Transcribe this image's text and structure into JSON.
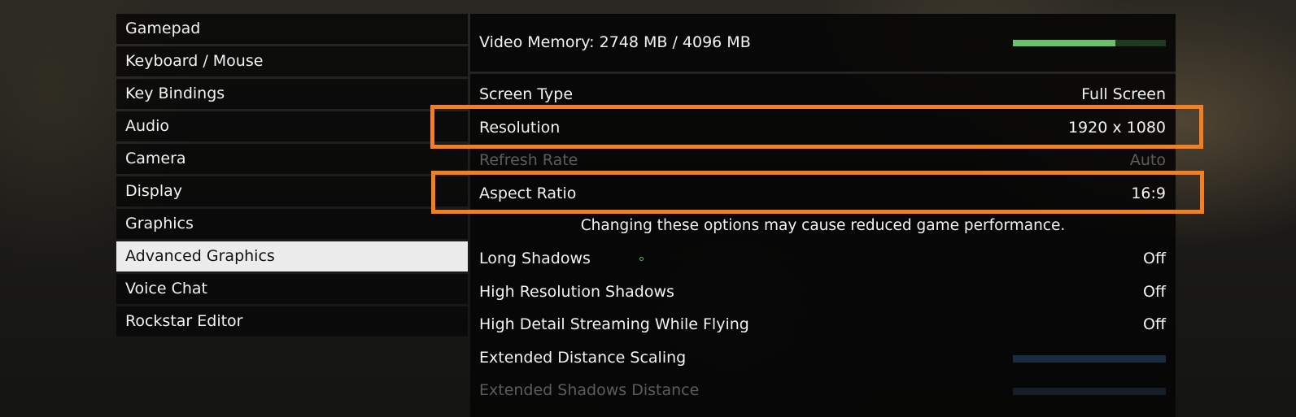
{
  "menu": {
    "items": [
      {
        "label": "Gamepad",
        "active": false
      },
      {
        "label": "Keyboard / Mouse",
        "active": false
      },
      {
        "label": "Key Bindings",
        "active": false
      },
      {
        "label": "Audio",
        "active": false
      },
      {
        "label": "Camera",
        "active": false
      },
      {
        "label": "Display",
        "active": false
      },
      {
        "label": "Graphics",
        "active": false
      },
      {
        "label": "Advanced Graphics",
        "active": true
      },
      {
        "label": "Voice Chat",
        "active": false
      },
      {
        "label": "Rockstar Editor",
        "active": false
      }
    ]
  },
  "video_memory": {
    "label": "Video Memory: 2748 MB / 4096 MB",
    "used_mb": 2748,
    "total_mb": 4096,
    "bar_fill_fraction": 0.67,
    "bar_color": "#6cc26a"
  },
  "settings": {
    "screen_type": {
      "label": "Screen Type",
      "value": "Full Screen"
    },
    "resolution": {
      "label": "Resolution",
      "value": "1920 x 1080"
    },
    "refresh_rate": {
      "label": "Refresh Rate",
      "value": "Auto"
    },
    "aspect_ratio": {
      "label": "Aspect Ratio",
      "value": "16:9"
    },
    "notice": "Changing these options may cause reduced game performance.",
    "long_shadows": {
      "label": "Long Shadows",
      "value": "Off"
    },
    "high_res_shadows": {
      "label": "High Resolution Shadows",
      "value": "Off"
    },
    "high_detail_streaming": {
      "label": "High Detail Streaming While Flying",
      "value": "Off"
    },
    "extended_distance_scaling": {
      "label": "Extended Distance Scaling",
      "slider_fraction": 0
    },
    "extended_shadows_distance": {
      "label": "Extended Shadows Distance",
      "slider_fraction": 0
    }
  },
  "colors": {
    "highlight": "#f47f20",
    "active_menu_bg": "#ececec",
    "slider_track": "#1a2c42"
  }
}
